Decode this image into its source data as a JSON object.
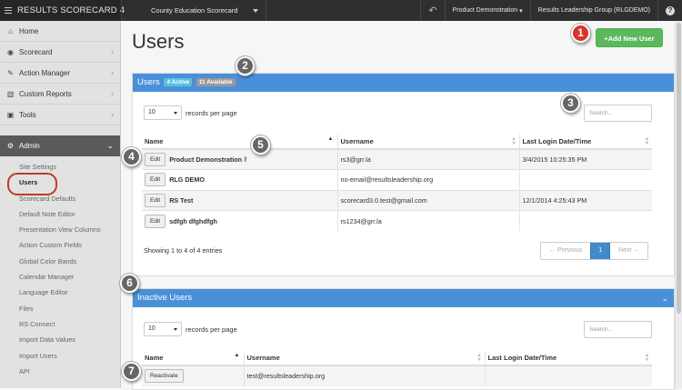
{
  "topbar": {
    "brand": "RESULTS SCORECARD 4",
    "scorecard_select": "County Education Scorecard",
    "demo_menu": "Product Demonstration",
    "org_menu": "Results Leadership Group (RLGDEMO)",
    "undo_icon": "undo-icon",
    "help_icon": "help-icon"
  },
  "sidebar": {
    "items": [
      {
        "label": "Home",
        "icon": "home-icon"
      },
      {
        "label": "Scorecard",
        "icon": "scorecard-icon"
      },
      {
        "label": "Action Manager",
        "icon": "wrench-icon"
      },
      {
        "label": "Custom Reports",
        "icon": "chart-icon"
      },
      {
        "label": "Tools",
        "icon": "briefcase-icon"
      }
    ],
    "admin": {
      "label": "Admin",
      "icon": "gears-icon"
    },
    "admin_items": [
      "Site Settings",
      "Users",
      "Scorecard Defaults",
      "Default Note Editor",
      "Presentation View Columns",
      "Action Custom Fields",
      "Global Color Bands",
      "Calendar Manager",
      "Language Editor",
      "Files",
      "RS Connect",
      "Import Data Values",
      "Import Users",
      "API"
    ],
    "active_admin_item": "Users"
  },
  "page": {
    "title": "Users",
    "add_button": "+Add New User"
  },
  "users_panel": {
    "title": "Users",
    "active_badge": "4 Active",
    "available_badge": "11 Available",
    "rpp_value": "10",
    "rpp_label": "records per page",
    "search_placeholder": "Search...",
    "columns": [
      "Name",
      "Username",
      "Last Login Date/Time"
    ],
    "rows": [
      {
        "button": "Edit",
        "name": "Product Demonstration",
        "username": "rs3@grr.la",
        "last_login": "3/4/2015 10:25:35 PM"
      },
      {
        "button": "Edit",
        "name": "RLG DEMO",
        "username": "no-email@resultsleadership.org",
        "last_login": ""
      },
      {
        "button": "Edit",
        "name": "RS Test",
        "username": "scorecard3.0.test@gmail.com",
        "last_login": "12/1/2014 4:25:43 PM"
      },
      {
        "button": "Edit",
        "name": "sdfgh dfghdfgh",
        "username": "rs1234@grr.la",
        "last_login": ""
      }
    ],
    "showing": "Showing 1 to 4 of 4 entries",
    "pager": {
      "previous": "← Previous",
      "current": "1",
      "next": "Next →"
    }
  },
  "inactive_panel": {
    "title": "Inactive Users",
    "rpp_value": "10",
    "rpp_label": "records per page",
    "search_placeholder": "Search...",
    "columns": [
      "Name",
      "Username",
      "Last Login Date/Time"
    ],
    "rows": [
      {
        "button": "Reactivate",
        "name": "",
        "username": "test@resultsleadership.org",
        "last_login": ""
      }
    ]
  },
  "markers": [
    "1",
    "2",
    "3",
    "4",
    "5",
    "6",
    "7"
  ],
  "colors": {
    "panel_header": "#4a90d9",
    "add_button": "#5cb85c",
    "marker": "#d9342b",
    "sidebar_active": "#5a5a5a"
  }
}
